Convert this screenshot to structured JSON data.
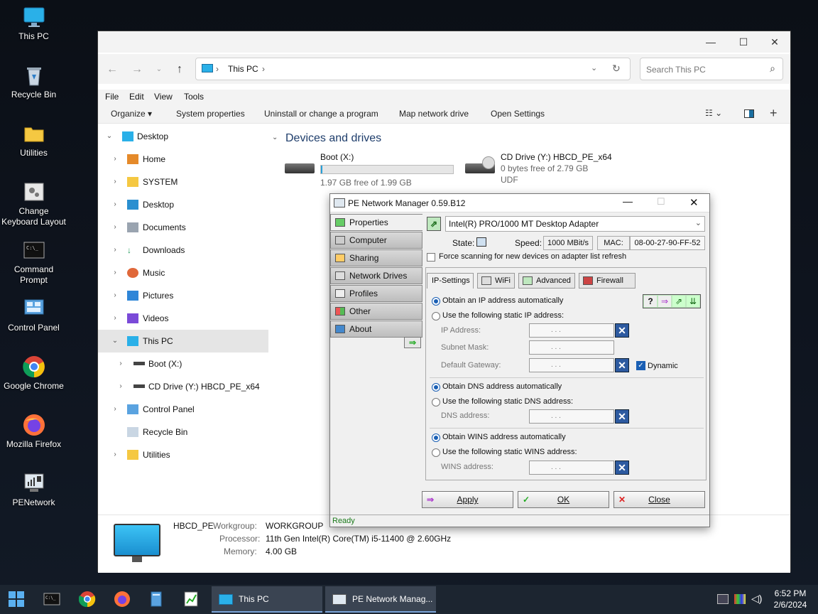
{
  "desktop": {
    "icons": [
      {
        "label": "This PC",
        "icon": "monitor-icon"
      },
      {
        "label": "Recycle Bin",
        "icon": "recycle-bin-icon"
      },
      {
        "label": "Utilities",
        "icon": "folder-icon"
      },
      {
        "label": "Change Keyboard Layout",
        "icon": "keyboard-settings-icon"
      },
      {
        "label": "Command Prompt",
        "icon": "command-prompt-icon"
      },
      {
        "label": "Control Panel",
        "icon": "control-panel-icon"
      },
      {
        "label": "Google Chrome",
        "icon": "chrome-icon"
      },
      {
        "label": "Mozilla Firefox",
        "icon": "firefox-icon"
      },
      {
        "label": "PENetwork",
        "icon": "network-icon"
      }
    ]
  },
  "explorer": {
    "address": {
      "location": "This PC",
      "sep1": "›",
      "sep2": "›"
    },
    "search_placeholder": "Search This PC",
    "menu": {
      "file": "File",
      "edit": "Edit",
      "view": "View",
      "tools": "Tools"
    },
    "commands": {
      "organize": "Organize ▾",
      "system_properties": "System properties",
      "uninstall": "Uninstall or change a program",
      "map_drive": "Map network drive",
      "open_settings": "Open Settings"
    },
    "tree": [
      {
        "label": "Desktop"
      },
      {
        "label": "Home"
      },
      {
        "label": "SYSTEM"
      },
      {
        "label": "Desktop"
      },
      {
        "label": "Documents"
      },
      {
        "label": "Downloads"
      },
      {
        "label": "Music"
      },
      {
        "label": "Pictures"
      },
      {
        "label": "Videos"
      },
      {
        "label": "This PC"
      },
      {
        "label": "Boot (X:)"
      },
      {
        "label": "CD Drive (Y:) HBCD_PE_x64"
      },
      {
        "label": "Control Panel"
      },
      {
        "label": "Recycle Bin"
      },
      {
        "label": "Utilities"
      }
    ],
    "section_title": "Devices and drives",
    "drives": [
      {
        "name": "Boot (X:)",
        "free": "1.97 GB free of 1.99 GB",
        "used_fraction": 0.01
      },
      {
        "name": "CD Drive (Y:) HBCD_PE_x64",
        "free": "0 bytes free of 2.79 GB",
        "fs": "UDF"
      }
    ],
    "details": {
      "pc_name": "HBCD_PE",
      "workgroup_label": "Workgroup:",
      "workgroup": "WORKGROUP",
      "processor_label": "Processor:",
      "processor": "11th Gen Intel(R) Core(TM) i5-11400 @ 2.60GHz",
      "memory_label": "Memory:",
      "memory": "4.00 GB"
    }
  },
  "pnm": {
    "title": "PE Network Manager 0.59.B12",
    "sidebar": [
      "Properties",
      "Computer",
      "Sharing",
      "Network Drives",
      "Profiles",
      "Other",
      "About"
    ],
    "adapter": "Intel(R) PRO/1000 MT Desktop Adapter",
    "state_label": "State:",
    "speed_label": "Speed:",
    "speed": "1000 MBit/s",
    "mac_label": "MAC:",
    "mac": "08-00-27-90-FF-52",
    "force_scan": "Force scanning for new devices on adapter list refresh",
    "tabs": [
      "IP-Settings",
      "WiFi",
      "Advanced",
      "Firewall"
    ],
    "ip": {
      "auto": "Obtain an IP address automatically",
      "static": "Use the following static IP address:",
      "ip_label": "IP Address:",
      "mask_label": "Subnet Mask:",
      "gateway_label": "Default Gateway:",
      "dynamic": "Dynamic",
      "dns_auto": "Obtain DNS address automatically",
      "dns_static": "Use the following static DNS address:",
      "dns_label": "DNS address:",
      "wins_auto": "Obtain WINS address automatically",
      "wins_static": "Use the following static WINS address:",
      "wins_label": "WINS address:",
      "dots": ".    .    ."
    },
    "buttons": {
      "apply": "Apply",
      "ok": "OK",
      "close": "Close"
    },
    "status": "Ready"
  },
  "taskbar": {
    "apps": [
      {
        "label": "This PC"
      },
      {
        "label": "PE Network Manag..."
      }
    ],
    "time": "6:52 PM",
    "date": "2/6/2024"
  }
}
